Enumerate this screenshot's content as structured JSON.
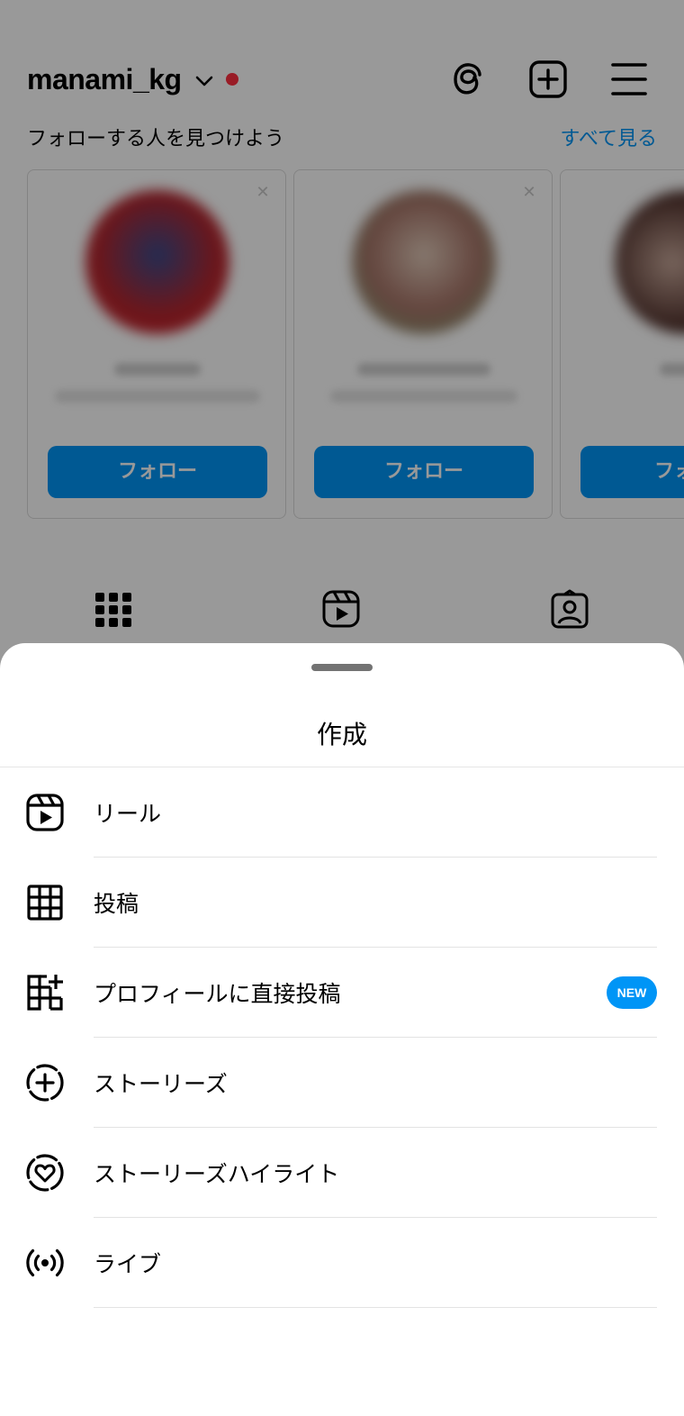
{
  "profile": {
    "username": "manami_kg",
    "suggest_title": "フォローする人を見つけよう",
    "see_all": "すべて見る",
    "cards": [
      {
        "follow_label": "フォロー"
      },
      {
        "follow_label": "フォロー"
      },
      {
        "follow_label": "フォ"
      }
    ],
    "icons": {
      "threads": "threads-icon",
      "create": "plus-square-icon",
      "menu": "hamburger-menu-icon"
    },
    "tabs": [
      "grid-icon",
      "reels-icon",
      "tagged-icon"
    ]
  },
  "sheet": {
    "title": "作成",
    "items": [
      {
        "label": "リール",
        "icon": "reels-icon"
      },
      {
        "label": "投稿",
        "icon": "grid-icon"
      },
      {
        "label": "プロフィールに直接投稿",
        "icon": "grid-plus-icon",
        "badge": "NEW"
      },
      {
        "label": "ストーリーズ",
        "icon": "story-add-icon"
      },
      {
        "label": "ストーリーズハイライト",
        "icon": "highlight-heart-icon"
      },
      {
        "label": "ライブ",
        "icon": "live-broadcast-icon"
      }
    ]
  },
  "colors": {
    "accent": "#0095f6",
    "notification": "#ff3040",
    "overlay": "rgba(0,0,0,0.40)"
  }
}
